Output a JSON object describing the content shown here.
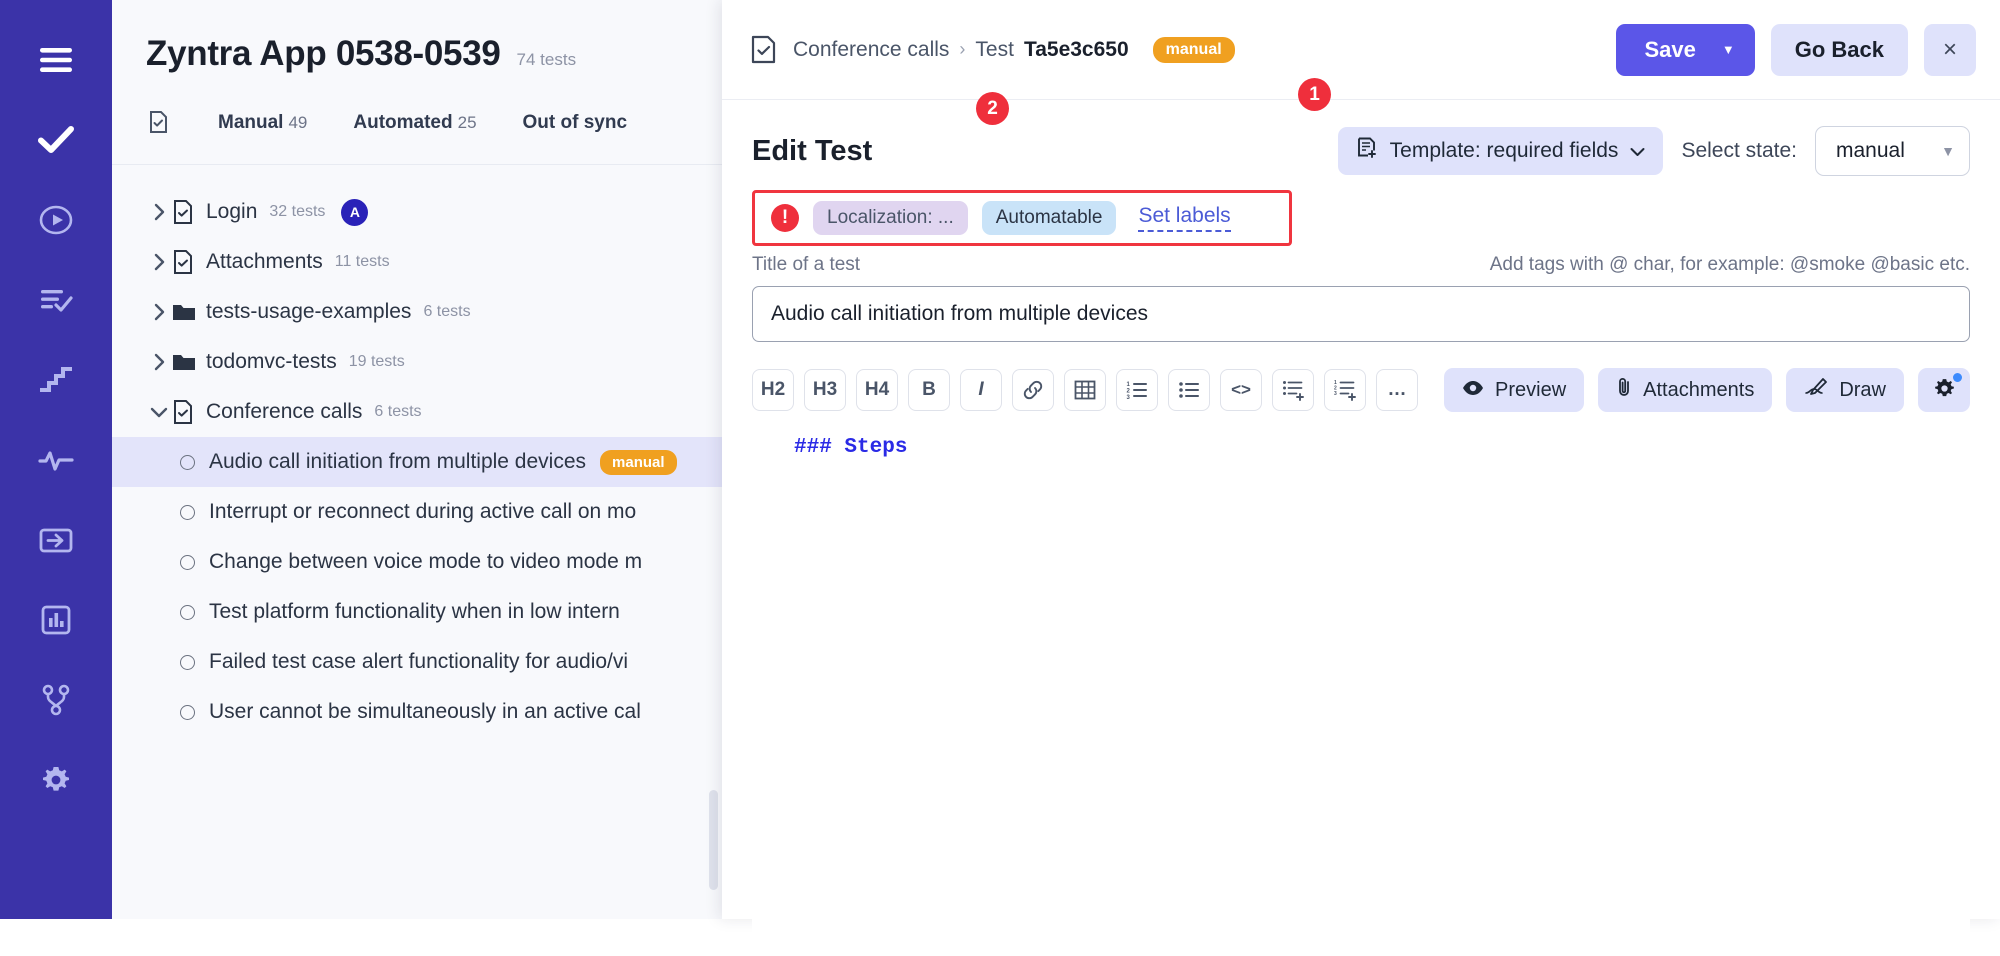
{
  "rail": {
    "items": [
      {
        "name": "menu-icon",
        "active": false
      },
      {
        "name": "check-icon",
        "active": true
      },
      {
        "name": "play-circle-icon",
        "active": false
      },
      {
        "name": "list-check-icon",
        "active": false
      },
      {
        "name": "stairs-icon",
        "active": false
      },
      {
        "name": "activity-pulse-icon",
        "active": false
      },
      {
        "name": "import-icon",
        "active": false
      },
      {
        "name": "bar-chart-icon",
        "active": false
      },
      {
        "name": "git-branch-icon",
        "active": false
      },
      {
        "name": "gear-icon",
        "active": false
      }
    ]
  },
  "list_panel": {
    "project_title": "Zyntra App 0538-0539",
    "project_count": "74 tests",
    "tabs": [
      {
        "label": "Manual",
        "count": "49"
      },
      {
        "label": "Automated",
        "count": "25"
      },
      {
        "label": "Out of sync",
        "count": ""
      }
    ],
    "tree": [
      {
        "type": "file",
        "name": "Login",
        "count": "32 tests",
        "expanded": false,
        "avatar": "A"
      },
      {
        "type": "file",
        "name": "Attachments",
        "count": "11 tests",
        "expanded": false,
        "avatar": ""
      },
      {
        "type": "folder",
        "name": "tests-usage-examples",
        "count": "6 tests",
        "expanded": false,
        "avatar": ""
      },
      {
        "type": "folder",
        "name": "todomvc-tests",
        "count": "19 tests",
        "expanded": false,
        "avatar": ""
      },
      {
        "type": "file",
        "name": "Conference calls",
        "count": "6 tests",
        "expanded": true,
        "avatar": ""
      }
    ],
    "tests": [
      {
        "label": "Audio call initiation from multiple devices",
        "badge": "manual",
        "selected": true
      },
      {
        "label": "Interrupt or reconnect during active call on mo",
        "badge": "",
        "selected": false
      },
      {
        "label": "Change between voice mode to video mode m",
        "badge": "",
        "selected": false
      },
      {
        "label": "Test platform functionality when in low intern",
        "badge": "",
        "selected": false
      },
      {
        "label": "Failed test case alert functionality for audio/vi",
        "badge": "",
        "selected": false
      },
      {
        "label": "User cannot be simultaneously in an active cal",
        "badge": "",
        "selected": false
      }
    ]
  },
  "detail": {
    "breadcrumb": {
      "parent": "Conference calls",
      "separator": "›",
      "test_prefix": "Test",
      "test_id": "Ta5e3c650",
      "badge": "manual"
    },
    "actions": {
      "save_label": "Save",
      "save_caret": "▼",
      "go_back_label": "Go Back",
      "close_label": "×"
    },
    "markers": {
      "one": "1",
      "two": "2"
    },
    "heading": "Edit Test",
    "template_button": "Template: required fields",
    "template_caret": "⌄",
    "select_state_label": "Select state:",
    "state_value": "manual",
    "state_arrow": "▼",
    "labels": {
      "error_mark": "!",
      "chips": [
        "Localization: ...",
        "Automatable"
      ],
      "set_labels": "Set labels"
    },
    "title_field_label": "Title of a test",
    "tags_hint": "Add tags with @ char, for example: @smoke @basic etc.",
    "title_value": "Audio call initiation from multiple devices",
    "toolbar": [
      {
        "label": "H2",
        "name": "heading-2-button"
      },
      {
        "label": "H3",
        "name": "heading-3-button"
      },
      {
        "label": "H4",
        "name": "heading-4-button"
      },
      {
        "label": "B",
        "name": "bold-button"
      },
      {
        "label": "I",
        "name": "italic-button"
      },
      {
        "label": "🔗",
        "name": "link-icon"
      },
      {
        "label": "⊞",
        "name": "table-icon"
      },
      {
        "label": "≣",
        "name": "ordered-list-icon"
      },
      {
        "label": "☰",
        "name": "bullet-list-icon"
      },
      {
        "label": "<>",
        "name": "code-icon"
      },
      {
        "label": "≣₊",
        "name": "add-bullet-list-icon"
      },
      {
        "label": "≣₊",
        "name": "add-ordered-list-icon"
      },
      {
        "label": "…",
        "name": "more-options-icon"
      }
    ],
    "toolbar_right": [
      {
        "label": "Preview",
        "name": "preview-button",
        "icon": "eye-icon"
      },
      {
        "label": "Attachments",
        "name": "attachments-button",
        "icon": "paperclip-icon"
      },
      {
        "label": "Draw",
        "name": "draw-button",
        "icon": "pen-icon"
      }
    ],
    "settings_button": "gear-icon",
    "editor_content": "### Steps"
  },
  "colors": {
    "rail": "#3b33a8",
    "accent": "#5b56e8",
    "accent_soft": "#dfe2fb",
    "warning": "#f0a020",
    "danger": "#ef2f3c",
    "selected_row": "#e3e4fa",
    "panel_bg": "#f8f9fc",
    "markdown": "#2a2ae6"
  }
}
